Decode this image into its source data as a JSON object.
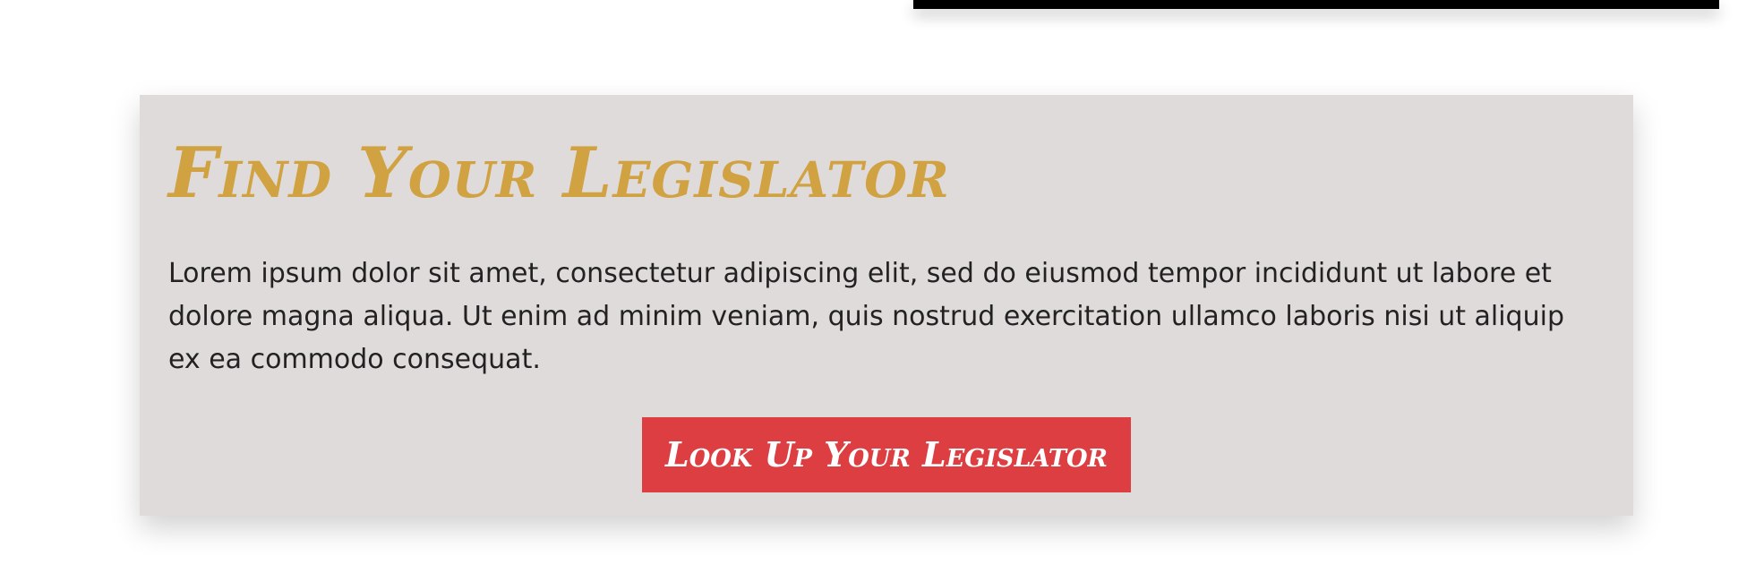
{
  "legislator_section": {
    "title": "Find Your Legislator",
    "body": "Lorem ipsum dolor sit amet, consectetur adipiscing elit, sed do eiusmod tempor incididunt ut labore et dolore magna aliqua. Ut enim ad minim veniam, quis nostrud exercitation ullamco laboris nisi ut aliquip ex ea commodo consequat.",
    "button_label": "Look Up Your Legislator"
  },
  "colors": {
    "card_background": "#e0dbdb",
    "title": "#d0a242",
    "button": "#dc3e41",
    "body_text": "#222222",
    "top_bar": "#000000"
  }
}
